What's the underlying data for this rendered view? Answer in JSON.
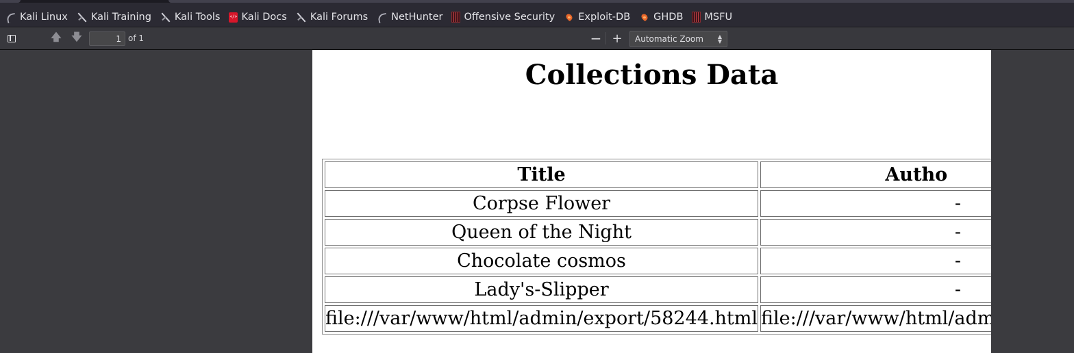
{
  "bookmarks": [
    {
      "label": "Kali Linux",
      "icon": "kali-dragon-icon"
    },
    {
      "label": "Kali Training",
      "icon": "kali-sword-icon"
    },
    {
      "label": "Kali Tools",
      "icon": "kali-sword-icon"
    },
    {
      "label": "Kali Docs",
      "icon": "kali-docs-icon"
    },
    {
      "label": "Kali Forums",
      "icon": "kali-sword-icon"
    },
    {
      "label": "NetHunter",
      "icon": "kali-dragon-icon"
    },
    {
      "label": "Offensive Security",
      "icon": "offsec-icon"
    },
    {
      "label": "Exploit-DB",
      "icon": "exploitdb-icon"
    },
    {
      "label": "GHDB",
      "icon": "ghdb-icon"
    },
    {
      "label": "MSFU",
      "icon": "offsec-icon"
    }
  ],
  "pdf_toolbar": {
    "page_number": "1",
    "page_count": "of 1",
    "zoom": "Automatic Zoom",
    "zoom_out_symbol": "−",
    "zoom_in_symbol": "+"
  },
  "document": {
    "title": "Collections Data",
    "headers": {
      "title": "Title",
      "author": "Autho"
    },
    "rows": [
      {
        "title": "Corpse Flower",
        "author": "-"
      },
      {
        "title": "Queen of the Night",
        "author": "-"
      },
      {
        "title": "Chocolate cosmos",
        "author": "-"
      },
      {
        "title": "Lady's-Slipper",
        "author": "-"
      },
      {
        "title": "file:///var/www/html/admin/export/58244.html",
        "author": "file:///var/www/html/adm"
      }
    ],
    "highlight_color": "#e0202a"
  }
}
